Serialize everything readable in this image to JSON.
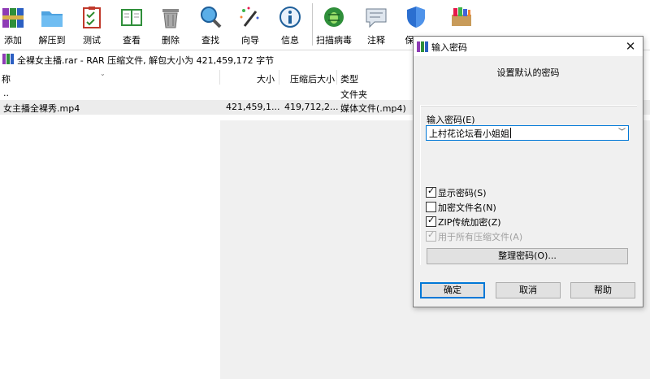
{
  "toolbar": {
    "buttons": [
      {
        "label": "添加",
        "icon": "add-archive-icon"
      },
      {
        "label": "解压到",
        "icon": "extract-folder-icon"
      },
      {
        "label": "测试",
        "icon": "test-clipboard-icon"
      },
      {
        "label": "查看",
        "icon": "view-book-icon"
      },
      {
        "label": "删除",
        "icon": "trash-icon"
      },
      {
        "label": "查找",
        "icon": "magnifier-icon"
      },
      {
        "label": "向导",
        "icon": "wizard-wand-icon"
      },
      {
        "label": "信息",
        "icon": "info-icon"
      },
      {
        "label": "扫描病毒",
        "icon": "virus-scan-icon"
      },
      {
        "label": "注释",
        "icon": "comment-icon"
      },
      {
        "label": "保",
        "icon": "shield-icon"
      },
      {
        "label": "",
        "icon": "books-icon"
      }
    ]
  },
  "addressbar": {
    "text": "全裸女主播.rar - RAR 压缩文件, 解包大小为 421,459,172 字节"
  },
  "columns": {
    "name": "称",
    "size": "大小",
    "packed": "压缩后大小",
    "type": "类型"
  },
  "rows": [
    {
      "name": "..",
      "size": "",
      "packed": "",
      "type": "文件夹"
    },
    {
      "name": "女主播全裸秀.mp4",
      "size": "421,459,1...",
      "packed": "419,712,2...",
      "type": "媒体文件(.mp4)"
    }
  ],
  "dialog": {
    "title": "输入密码",
    "close": "✕",
    "subtitle": "设置默认的密码",
    "password_label": "输入密码(E)",
    "password_value": "上村花论坛看小姐姐",
    "checkboxes": [
      {
        "label": "显示密码(S)",
        "checked": true,
        "disabled": false
      },
      {
        "label": "加密文件名(N)",
        "checked": false,
        "disabled": false
      },
      {
        "label": "ZIP传统加密(Z)",
        "checked": true,
        "disabled": false
      },
      {
        "label": "用于所有压缩文件(A)",
        "checked": true,
        "disabled": true
      }
    ],
    "organize_button": "整理密码(O)...",
    "ok_button": "确定",
    "cancel_button": "取消",
    "help_button": "帮助"
  },
  "colors": {
    "accent": "#0078d7",
    "selection": "#ececec",
    "dialog_bg": "#f0f0f0"
  }
}
